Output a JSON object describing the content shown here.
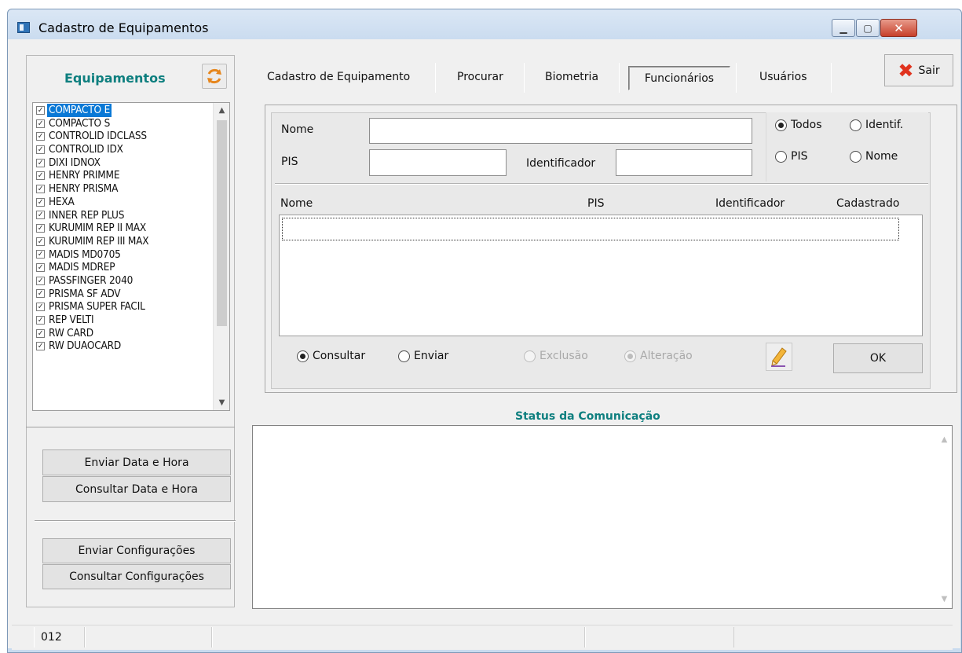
{
  "window": {
    "title": "Cadastro de Equipamentos",
    "min_icon": "minimize-icon",
    "max_icon": "maximize-icon",
    "close_icon": "close-icon"
  },
  "equipments": {
    "title": "Equipamentos",
    "refresh_icon": "refresh-icon",
    "items": [
      "COMPACTO E",
      "COMPACTO S",
      "CONTROLID IDCLASS",
      "CONTROLID IDX",
      "DIXI IDNOX",
      "HENRY PRIMME",
      "HENRY PRISMA",
      "HEXA",
      "INNER REP PLUS",
      "KURUMIM REP II MAX",
      "KURUMIM REP III MAX",
      "MADIS MD0705",
      "MADIS MDREP",
      "PASSFINGER 2040",
      "PRISMA SF ADV",
      "PRISMA SUPER FACIL",
      "REP VELTI",
      "RW CARD",
      "RW DUAOCARD"
    ],
    "selected_index": 0,
    "all_checked": true
  },
  "left_buttons": {
    "send_datetime": "Enviar Data e Hora",
    "query_datetime": "Consultar Data e Hora",
    "send_config": "Enviar Configurações",
    "query_config": "Consultar Configurações"
  },
  "tabs": [
    "Cadastro de Equipamento",
    "Procurar",
    "Biometria",
    "Funcionários",
    "Usuários"
  ],
  "active_tab": "Funcionários",
  "sair_label": "Sair",
  "filter": {
    "nome_label": "Nome",
    "pis_label": "PIS",
    "identificador_label": "Identificador",
    "nome_value": "",
    "pis_value": "",
    "identificador_value": "",
    "radios": {
      "todos": "Todos",
      "identif": "Identif.",
      "pis": "PIS",
      "nome": "Nome",
      "selected": "Todos"
    }
  },
  "grid": {
    "columns": [
      "Nome",
      "PIS",
      "Identificador",
      "Cadastrado"
    ],
    "rows": []
  },
  "actions": {
    "consultar": "Consultar",
    "enviar": "Enviar",
    "exclusao": "Exclusão",
    "alteracao": "Alteração",
    "selected": "Consultar",
    "edit_icon": "pencil-icon",
    "ok": "OK"
  },
  "status": {
    "title": "Status da Comunicação",
    "text": ""
  },
  "statusbar": {
    "cell1": "012"
  }
}
